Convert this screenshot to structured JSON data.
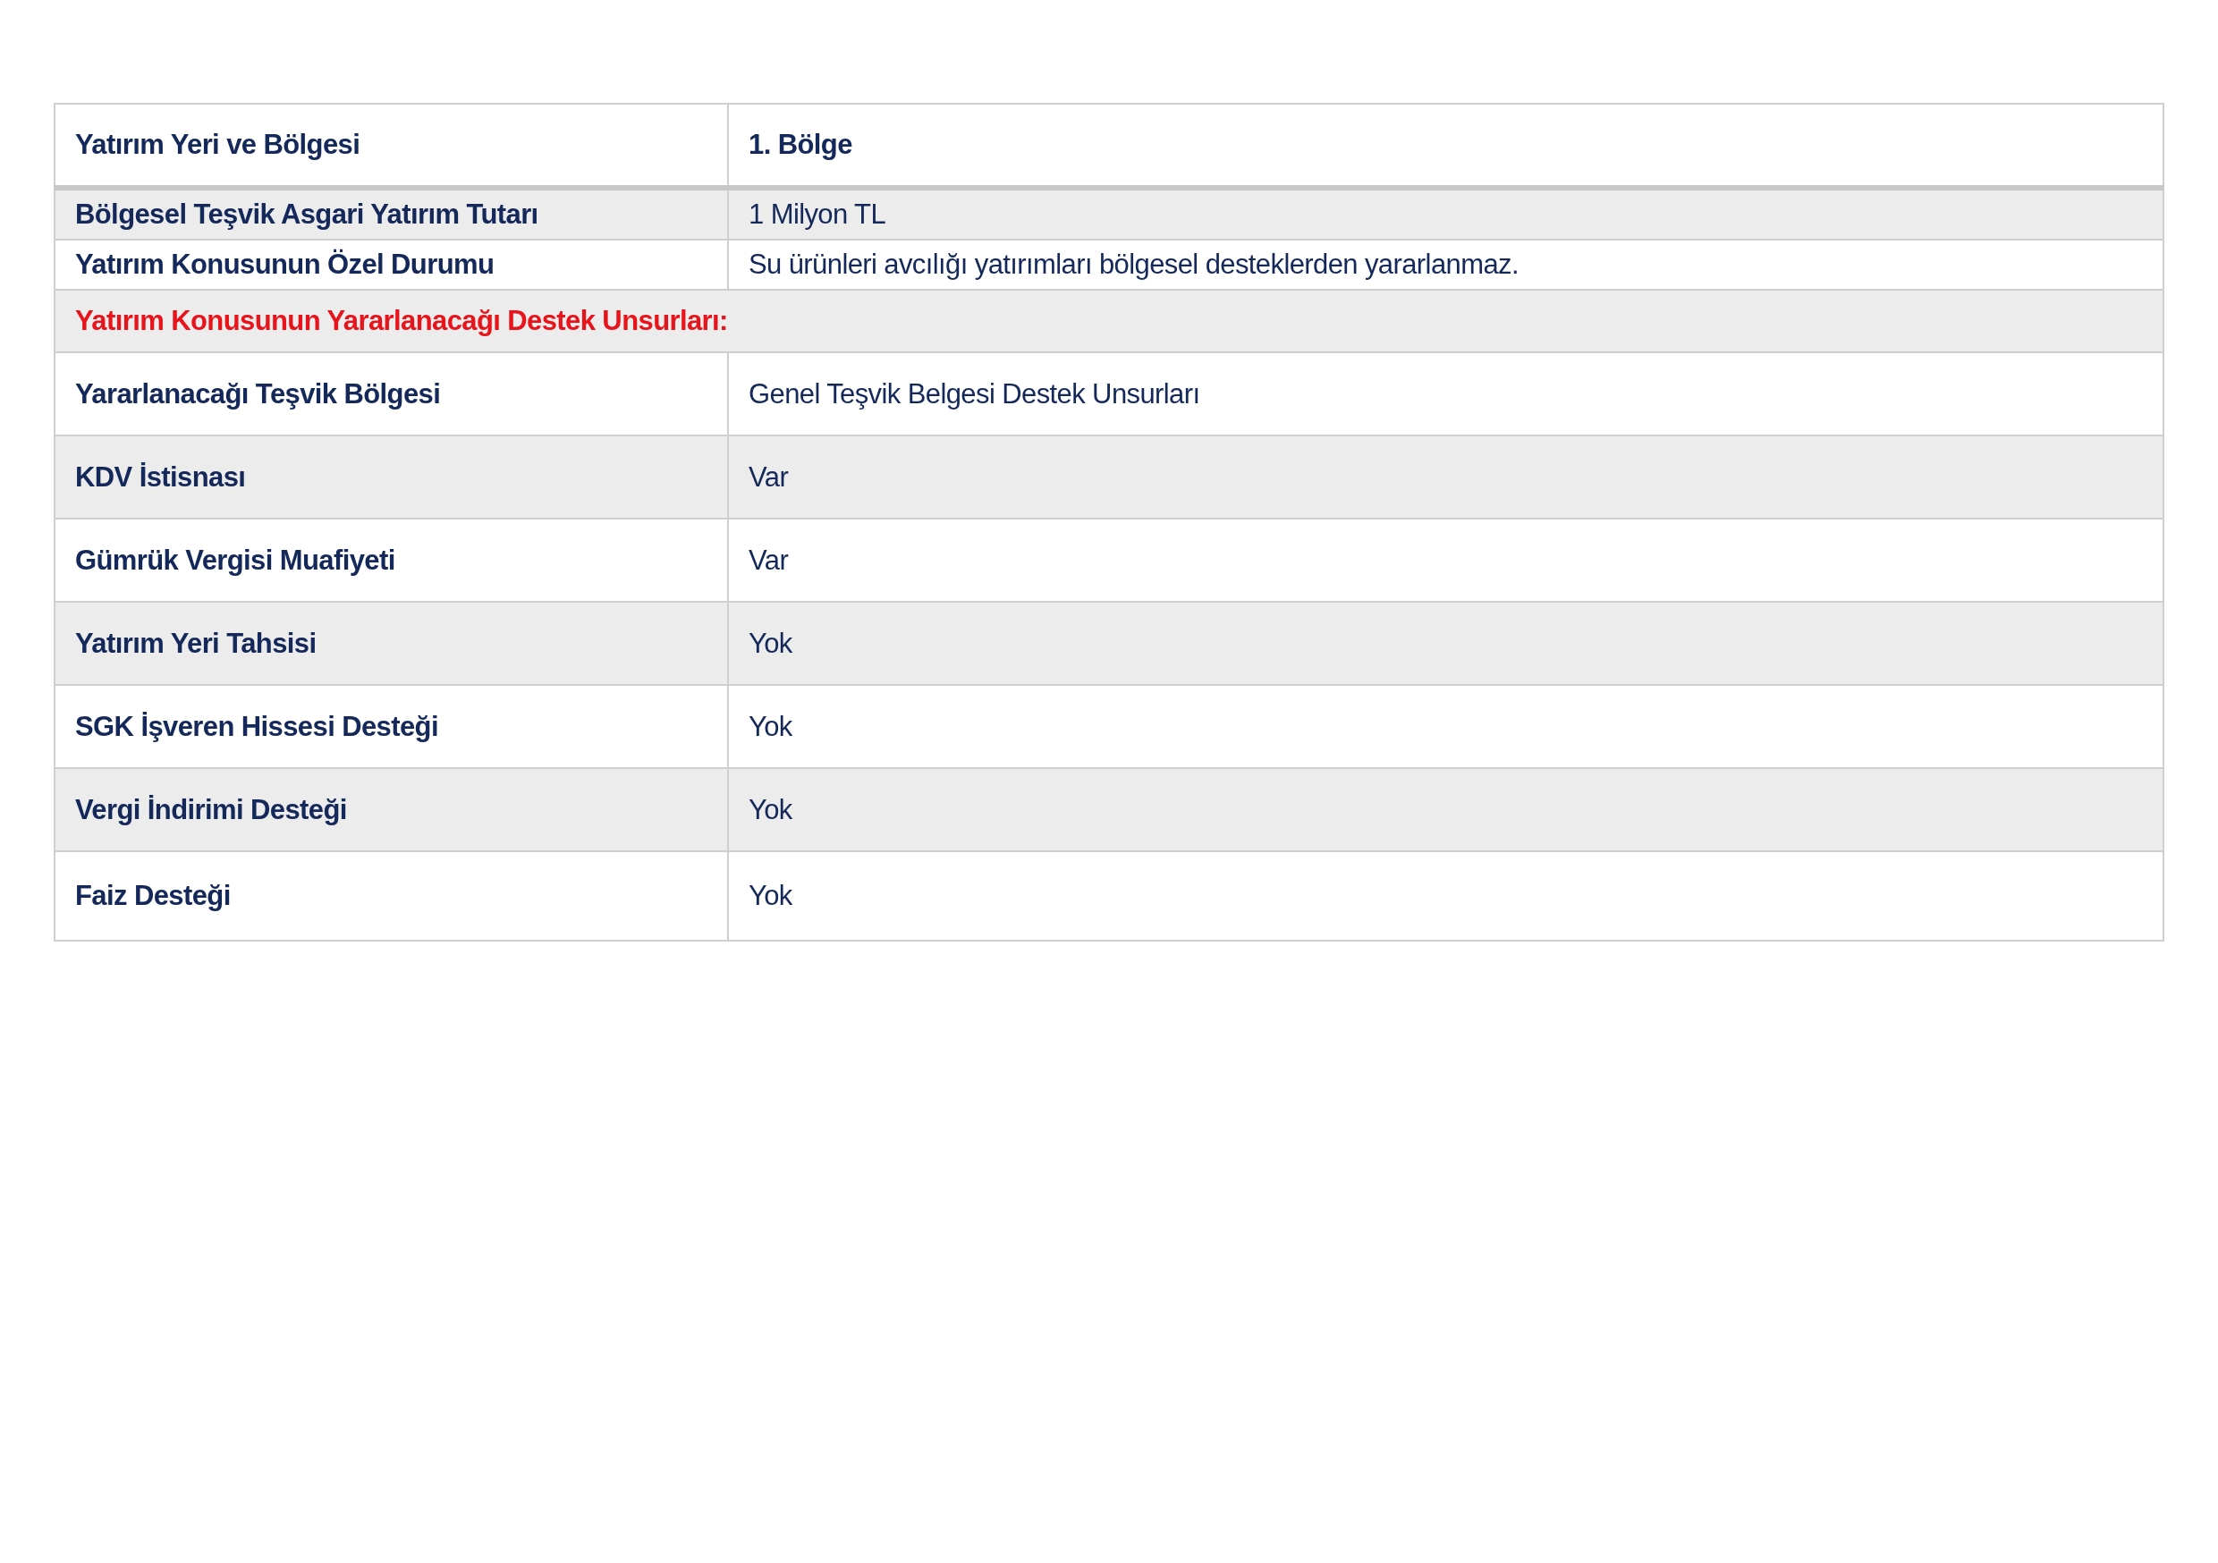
{
  "table": {
    "rows": [
      {
        "kind": "header",
        "label": "Yatırım Yeri ve Bölgesi",
        "value": "1. Bölge"
      },
      {
        "kind": "compact",
        "label": "Bölgesel Teşvik Asgari Yatırım Tutarı",
        "value": "1 Milyon TL"
      },
      {
        "kind": "compact",
        "label": "Yatırım Konusunun Özel Durumu",
        "value": "Su ürünleri avcılığı yatırımları bölgesel desteklerden yararlanmaz."
      },
      {
        "kind": "section",
        "label": "Yatırım Konusunun Yararlanacağı Destek Unsurları:"
      },
      {
        "kind": "pair",
        "label": "Yararlanacağı Teşvik Bölgesi",
        "value": "Genel Teşvik Belgesi Destek Unsurları"
      },
      {
        "kind": "pair",
        "label": "KDV İstisnası",
        "value": "Var"
      },
      {
        "kind": "pair",
        "label": "Gümrük Vergisi Muafiyeti",
        "value": "Var"
      },
      {
        "kind": "pair",
        "label": "Yatırım Yeri Tahsisi",
        "value": "Yok"
      },
      {
        "kind": "pair",
        "label": "SGK İşveren Hissesi Desteği",
        "value": "Yok"
      },
      {
        "kind": "pair",
        "label": "Vergi İndirimi Desteği",
        "value": "Yok"
      },
      {
        "kind": "pair",
        "label": "Faiz Desteği",
        "value": "Yok"
      }
    ]
  }
}
